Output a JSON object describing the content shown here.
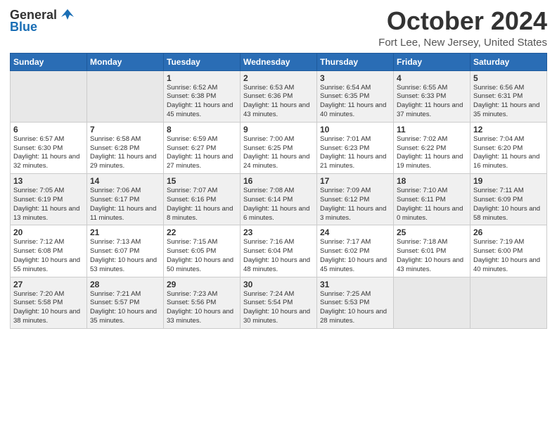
{
  "header": {
    "logo_general": "General",
    "logo_blue": "Blue",
    "month": "October 2024",
    "location": "Fort Lee, New Jersey, United States"
  },
  "weekdays": [
    "Sunday",
    "Monday",
    "Tuesday",
    "Wednesday",
    "Thursday",
    "Friday",
    "Saturday"
  ],
  "weeks": [
    [
      {
        "day": "",
        "info": ""
      },
      {
        "day": "",
        "info": ""
      },
      {
        "day": "1",
        "info": "Sunrise: 6:52 AM\nSunset: 6:38 PM\nDaylight: 11 hours and 45 minutes."
      },
      {
        "day": "2",
        "info": "Sunrise: 6:53 AM\nSunset: 6:36 PM\nDaylight: 11 hours and 43 minutes."
      },
      {
        "day": "3",
        "info": "Sunrise: 6:54 AM\nSunset: 6:35 PM\nDaylight: 11 hours and 40 minutes."
      },
      {
        "day": "4",
        "info": "Sunrise: 6:55 AM\nSunset: 6:33 PM\nDaylight: 11 hours and 37 minutes."
      },
      {
        "day": "5",
        "info": "Sunrise: 6:56 AM\nSunset: 6:31 PM\nDaylight: 11 hours and 35 minutes."
      }
    ],
    [
      {
        "day": "6",
        "info": "Sunrise: 6:57 AM\nSunset: 6:30 PM\nDaylight: 11 hours and 32 minutes."
      },
      {
        "day": "7",
        "info": "Sunrise: 6:58 AM\nSunset: 6:28 PM\nDaylight: 11 hours and 29 minutes."
      },
      {
        "day": "8",
        "info": "Sunrise: 6:59 AM\nSunset: 6:27 PM\nDaylight: 11 hours and 27 minutes."
      },
      {
        "day": "9",
        "info": "Sunrise: 7:00 AM\nSunset: 6:25 PM\nDaylight: 11 hours and 24 minutes."
      },
      {
        "day": "10",
        "info": "Sunrise: 7:01 AM\nSunset: 6:23 PM\nDaylight: 11 hours and 21 minutes."
      },
      {
        "day": "11",
        "info": "Sunrise: 7:02 AM\nSunset: 6:22 PM\nDaylight: 11 hours and 19 minutes."
      },
      {
        "day": "12",
        "info": "Sunrise: 7:04 AM\nSunset: 6:20 PM\nDaylight: 11 hours and 16 minutes."
      }
    ],
    [
      {
        "day": "13",
        "info": "Sunrise: 7:05 AM\nSunset: 6:19 PM\nDaylight: 11 hours and 13 minutes."
      },
      {
        "day": "14",
        "info": "Sunrise: 7:06 AM\nSunset: 6:17 PM\nDaylight: 11 hours and 11 minutes."
      },
      {
        "day": "15",
        "info": "Sunrise: 7:07 AM\nSunset: 6:16 PM\nDaylight: 11 hours and 8 minutes."
      },
      {
        "day": "16",
        "info": "Sunrise: 7:08 AM\nSunset: 6:14 PM\nDaylight: 11 hours and 6 minutes."
      },
      {
        "day": "17",
        "info": "Sunrise: 7:09 AM\nSunset: 6:12 PM\nDaylight: 11 hours and 3 minutes."
      },
      {
        "day": "18",
        "info": "Sunrise: 7:10 AM\nSunset: 6:11 PM\nDaylight: 11 hours and 0 minutes."
      },
      {
        "day": "19",
        "info": "Sunrise: 7:11 AM\nSunset: 6:09 PM\nDaylight: 10 hours and 58 minutes."
      }
    ],
    [
      {
        "day": "20",
        "info": "Sunrise: 7:12 AM\nSunset: 6:08 PM\nDaylight: 10 hours and 55 minutes."
      },
      {
        "day": "21",
        "info": "Sunrise: 7:13 AM\nSunset: 6:07 PM\nDaylight: 10 hours and 53 minutes."
      },
      {
        "day": "22",
        "info": "Sunrise: 7:15 AM\nSunset: 6:05 PM\nDaylight: 10 hours and 50 minutes."
      },
      {
        "day": "23",
        "info": "Sunrise: 7:16 AM\nSunset: 6:04 PM\nDaylight: 10 hours and 48 minutes."
      },
      {
        "day": "24",
        "info": "Sunrise: 7:17 AM\nSunset: 6:02 PM\nDaylight: 10 hours and 45 minutes."
      },
      {
        "day": "25",
        "info": "Sunrise: 7:18 AM\nSunset: 6:01 PM\nDaylight: 10 hours and 43 minutes."
      },
      {
        "day": "26",
        "info": "Sunrise: 7:19 AM\nSunset: 6:00 PM\nDaylight: 10 hours and 40 minutes."
      }
    ],
    [
      {
        "day": "27",
        "info": "Sunrise: 7:20 AM\nSunset: 5:58 PM\nDaylight: 10 hours and 38 minutes."
      },
      {
        "day": "28",
        "info": "Sunrise: 7:21 AM\nSunset: 5:57 PM\nDaylight: 10 hours and 35 minutes."
      },
      {
        "day": "29",
        "info": "Sunrise: 7:23 AM\nSunset: 5:56 PM\nDaylight: 10 hours and 33 minutes."
      },
      {
        "day": "30",
        "info": "Sunrise: 7:24 AM\nSunset: 5:54 PM\nDaylight: 10 hours and 30 minutes."
      },
      {
        "day": "31",
        "info": "Sunrise: 7:25 AM\nSunset: 5:53 PM\nDaylight: 10 hours and 28 minutes."
      },
      {
        "day": "",
        "info": ""
      },
      {
        "day": "",
        "info": ""
      }
    ]
  ]
}
